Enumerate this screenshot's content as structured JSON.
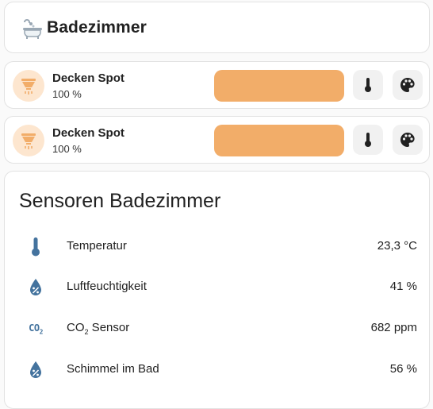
{
  "header": {
    "title": "Badezimmer",
    "icon": "bathtub-icon"
  },
  "lights": [
    {
      "name": "Decken Spot",
      "state": "100 %",
      "brightness_percent": 100,
      "icon": "ceiling-spot-icon"
    },
    {
      "name": "Decken Spot",
      "state": "100 %",
      "brightness_percent": 100,
      "icon": "ceiling-spot-icon"
    }
  ],
  "sensors": {
    "title": "Sensoren Badezimmer",
    "rows": [
      {
        "label": "Temperatur",
        "value": "23,3 °C",
        "icon": "thermometer-icon"
      },
      {
        "label": "Luftfeuchtigkeit",
        "value": "41 %",
        "icon": "water-percent-icon"
      },
      {
        "label": "CO",
        "label_sub": "2",
        "label_suffix": " Sensor",
        "value": "682 ppm",
        "icon": "co2-icon",
        "icon_text": "CO",
        "icon_sub": "2"
      },
      {
        "label": "Schimmel im Bad",
        "value": "56 %",
        "icon": "water-percent-icon"
      }
    ]
  },
  "colors": {
    "accent_orange": "#f2ad69",
    "icon_bg": "#fde6cf",
    "sensor_icon_blue": "#44739e"
  }
}
